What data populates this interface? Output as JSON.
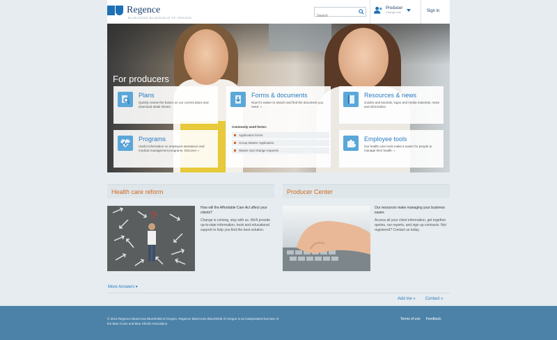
{
  "header": {
    "brand": "Regence",
    "tagline": "BLUECROSS BLUESHIELD OF OREGON",
    "search_placeholder": "Search",
    "role": "Producer",
    "role_sub": "Change role",
    "sign_in": "Sign in"
  },
  "hero": {
    "title": "For producers",
    "tiles": [
      {
        "title": "Plans",
        "desc": "Quickly review the basics on our current plans and download detail sheets."
      },
      {
        "title": "Forms & documents",
        "desc": "Now it's easier to search and find the document you need. »"
      },
      {
        "title": "Resources & news",
        "desc": "Guides and tutorials, logos and media materials, news and information."
      },
      {
        "title": "Programs",
        "desc": "Useful information on employee assistance and medical management programs. Discover »"
      },
      {
        "title": "Employee tools",
        "desc": "Our health care tools make it easier for people to manage their health. »"
      }
    ],
    "forms_sub": "Commonly used forms:",
    "forms_list": [
      "Application forms",
      "Group Master Application",
      "Waiver and change requests"
    ],
    "dots": "● ○ ○"
  },
  "health": {
    "heading": "Health care reform",
    "question": "How will the Affordable Care Act affect your clients?",
    "body": "Change is coming, stay with us. We'll provide up-to-date information, tools and educational support to help you find the best solution."
  },
  "producer": {
    "heading": "Producer Center",
    "question": "Our resources make managing your business easier.",
    "body": "Access all your client information, get together quotes, run reports, and sign up contracts. Not registered? Contact us today."
  },
  "more_link": "More Answers ▾",
  "bottom_links": [
    "Add me »",
    "Contact »"
  ],
  "footer": {
    "copyright": "© 2013 Regence BlueCross BlueShield of Oregon. Regence BlueCross BlueShield of Oregon is an independent licensee of the Blue Cross and Blue Shield Association.",
    "links": [
      "Terms of use",
      "Feedback"
    ]
  },
  "colors": {
    "brand_blue": "#1f6fb5",
    "accent_orange": "#cf6a20",
    "footer_blue": "#4d82a8"
  }
}
